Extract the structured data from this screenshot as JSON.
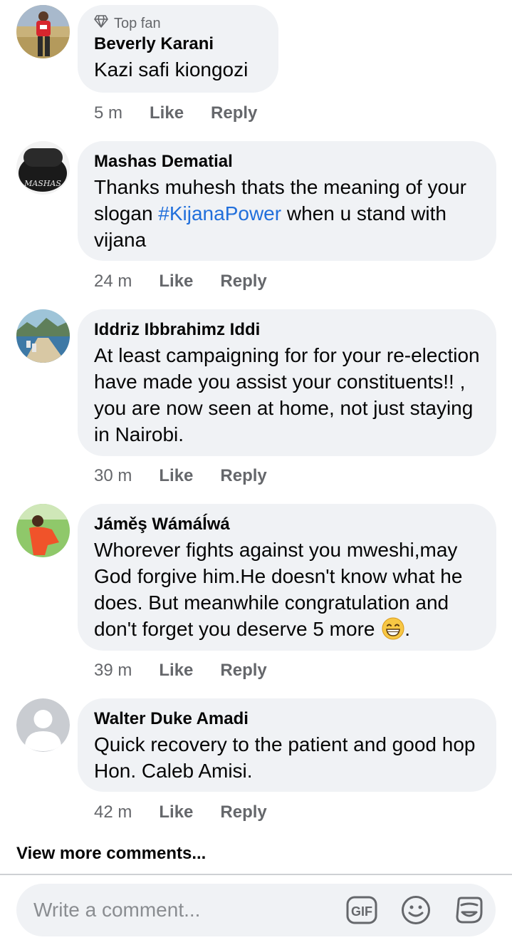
{
  "comments": [
    {
      "badge": "Top fan",
      "author": "Beverly Karani",
      "text": "Kazi safi kiongozi",
      "time": "5 m",
      "like": "Like",
      "reply": "Reply"
    },
    {
      "author": "Mashas Dematial",
      "text_before": "Thanks muhesh thats the meaning of your slogan ",
      "hashtag": "#KijanaPower",
      "text_after": " when u stand with vijana",
      "time": "24 m",
      "like": "Like",
      "reply": "Reply"
    },
    {
      "author": "Iddriz Ibbrahimz Iddi",
      "text": "At least campaigning for for your re-election have made you assist your constituents!! , you are now seen at home, not just staying in Nairobi.",
      "time": "30 m",
      "like": "Like",
      "reply": "Reply"
    },
    {
      "author": "Jáměş Wámáĺwá",
      "text": "Whorever fights against you mweshi,may God forgive him.He doesn't know what he does. But meanwhile congratulation and don't forget you deserve 5 more",
      "text_end": ".",
      "time": "39 m",
      "like": "Like",
      "reply": "Reply"
    },
    {
      "author": "Walter Duke Amadi",
      "text": "Quick recovery to the patient and good hop Hon. Caleb Amisi.",
      "time": "42 m",
      "like": "Like",
      "reply": "Reply"
    }
  ],
  "view_more": "View more comments...",
  "composer": {
    "placeholder": "Write a comment...",
    "icons": [
      "gif-icon",
      "emoji-icon",
      "sticker-icon"
    ]
  },
  "colors": {
    "bubble": "#f0f2f5",
    "hashtag": "#216fdb",
    "secondary_text": "#65676b"
  }
}
